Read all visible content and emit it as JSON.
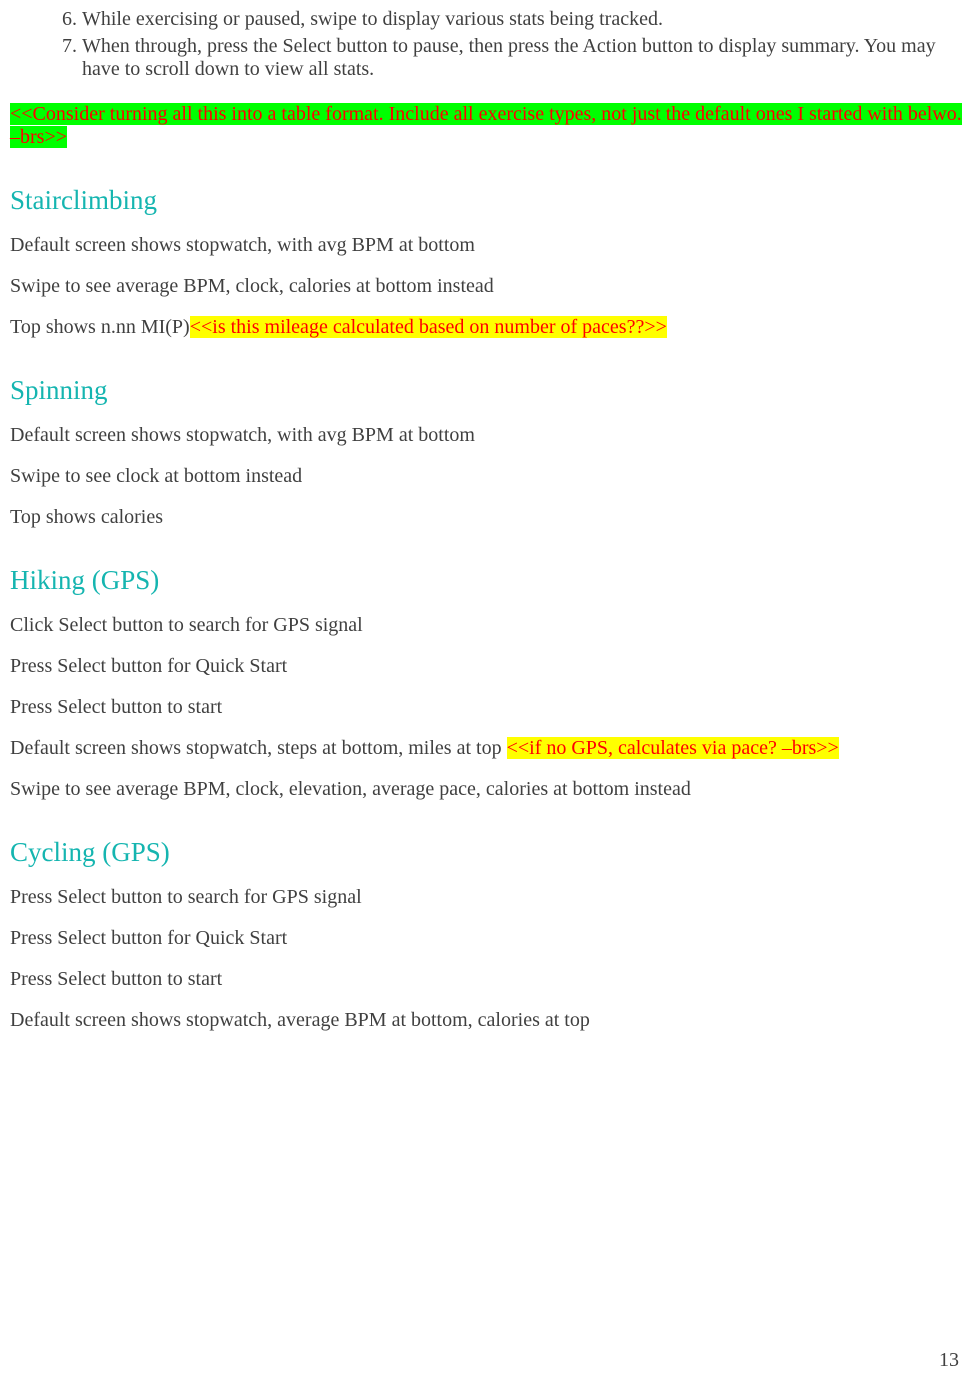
{
  "list": {
    "start": 6,
    "item6": "While exercising or paused, swipe to display various stats being tracked.",
    "item7": "When through, press the Select button to pause, then press the Action button to display summary. You may have to scroll down to view all stats."
  },
  "callout1": "<<Consider turning all this into a table format. Include all exercise types, not just the default ones I started with belwo. –brs>>",
  "stairclimbing": {
    "heading": "Stairclimbing",
    "p1": "Default screen shows stopwatch, with avg BPM at bottom",
    "p2": "Swipe to see average BPM, clock, calories at bottom instead",
    "p3_plain": "Top shows n.nn MI(P)",
    "p3_note": "<<is this mileage calculated based on number of paces??>>"
  },
  "spinning": {
    "heading": "Spinning",
    "p1": "Default screen shows stopwatch, with avg BPM at bottom",
    "p2": "Swipe to see clock at bottom instead",
    "p3": "Top shows calories"
  },
  "hiking": {
    "heading": "Hiking (GPS)",
    "p1": "Click Select button to search for GPS signal",
    "p2": "Press Select button for Quick Start",
    "p3": "Press Select button to start",
    "p4_plain": "Default screen shows stopwatch, steps at bottom, miles at top ",
    "p4_note": "<<if no GPS, calculates via pace? –brs>>",
    "p5": "Swipe to see average BPM, clock, elevation, average pace, calories at bottom instead"
  },
  "cycling": {
    "heading": "Cycling (GPS)",
    "p1": "Press Select button to search for GPS signal",
    "p2": "Press Select button for Quick Start",
    "p3": "Press Select button to start",
    "p4": "Default screen shows stopwatch, average BPM at bottom, calories at top"
  },
  "page_number": "13"
}
